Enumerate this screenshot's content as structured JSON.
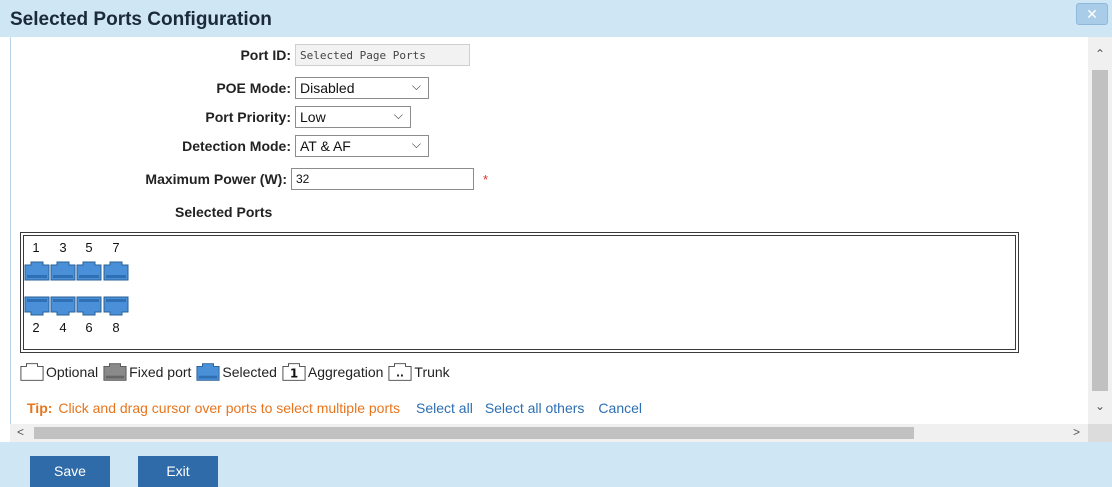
{
  "window": {
    "title": "Selected Ports Configuration",
    "close_glyph": "✕"
  },
  "form": {
    "port_id_label": "Port ID:",
    "port_id_value": "Selected Page Ports",
    "poe_mode_label": "POE Mode:",
    "poe_mode_value": "Disabled",
    "port_priority_label": "Port Priority:",
    "port_priority_value": "Low",
    "detection_mode_label": "Detection Mode:",
    "detection_mode_value": "AT & AF",
    "max_power_label": "Maximum Power (W):",
    "max_power_value": "32",
    "required_mark": "*",
    "selected_ports_title": "Selected Ports"
  },
  "ports": {
    "top_numbers": [
      "1",
      "3",
      "5",
      "7"
    ],
    "bottom_numbers": [
      "2",
      "4",
      "6",
      "8"
    ],
    "state": "Selected",
    "colors": {
      "selected": "#4a90d9",
      "fixed": "#8a8a8a",
      "optional": "#ffffff"
    }
  },
  "legend": {
    "optional": "Optional",
    "fixed_port": "Fixed port",
    "selected": "Selected",
    "aggregation": "Aggregation",
    "aggregation_glyph": "1",
    "trunk": "Trunk",
    "trunk_glyph": ".."
  },
  "tip": {
    "label": "Tip:",
    "text": "Click and drag cursor over ports to select multiple ports",
    "select_all": "Select all",
    "select_all_others": "Select all others",
    "cancel": "Cancel"
  },
  "scroll": {
    "up": "⌃",
    "down": "⌄",
    "left": "<",
    "right": ">"
  },
  "footer": {
    "save": "Save",
    "exit": "Exit"
  }
}
